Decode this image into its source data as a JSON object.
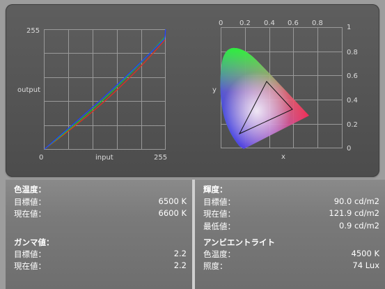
{
  "graphs": {
    "curve": {
      "y_max_label": "255",
      "x_min_label": "0",
      "x_max_label": "255",
      "y_axis_label": "output",
      "x_axis_label": "input"
    },
    "cie": {
      "top_ticks": [
        "0",
        "0.2",
        "0.4",
        "0.6",
        "0.8"
      ],
      "right_ticks": [
        "1",
        "0.8",
        "0.6",
        "0.4",
        "0.2",
        "0"
      ],
      "x_axis_label": "x",
      "y_axis_label": "y"
    }
  },
  "color_temp": {
    "header": "色温度：",
    "target_label": "目標値：",
    "target_value": "6500 K",
    "current_label": "現在値：",
    "current_value": "6600 K"
  },
  "gamma": {
    "header": "ガンマ値：",
    "target_label": "目標値：",
    "target_value": "2.2",
    "current_label": "現在値：",
    "current_value": "2.2"
  },
  "luminance": {
    "header": "輝度：",
    "target_label": "目標値：",
    "target_value": "90.0 cd/m2",
    "current_label": "現在値：",
    "current_value": "121.9 cd/m2",
    "min_label": "最低値：",
    "min_value": "0.9 cd/m2"
  },
  "ambient": {
    "header": "アンビエントライト",
    "temp_label": "色温度：",
    "temp_value": "4500 K",
    "illum_label": "照度：",
    "illum_value": "74 Lux"
  }
}
